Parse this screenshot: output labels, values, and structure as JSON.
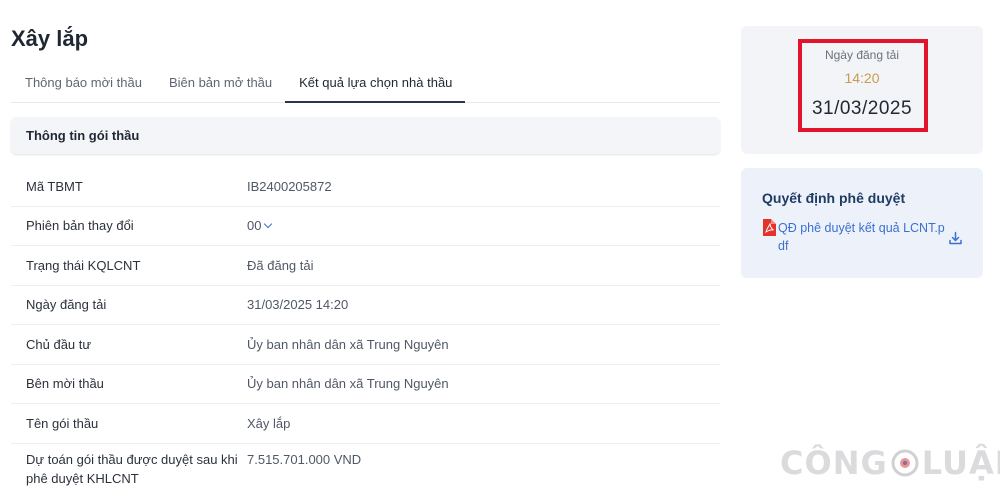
{
  "page": {
    "title": "Xây lắp"
  },
  "tabs": [
    {
      "label": "Thông báo mời thầu",
      "active": false
    },
    {
      "label": "Biên bản mở thầu",
      "active": false
    },
    {
      "label": "Kết quả lựa chọn nhà thầu",
      "active": true
    }
  ],
  "section": {
    "title": "Thông tin gói thầu"
  },
  "info": {
    "rows": [
      {
        "label": "Mã TBMT",
        "value": "IB2400205872"
      },
      {
        "label": "Phiên bản thay đổi",
        "value": "00"
      },
      {
        "label": "Trạng thái KQLCNT",
        "value": "Đã đăng tải"
      },
      {
        "label": "Ngày đăng tải",
        "value": "31/03/2025 14:20"
      },
      {
        "label": "Chủ đầu tư",
        "value": "Ủy ban nhân dân xã Trung Nguyên"
      },
      {
        "label": "Bên mời thầu",
        "value": "Ủy ban nhân dân xã Trung Nguyên"
      },
      {
        "label": "Tên gói thầu",
        "value": "Xây lắp"
      },
      {
        "label": "Dự toán gói thầu được duyệt sau khi phê duyệt KHLCNT",
        "value": "7.515.701.000 VND"
      }
    ]
  },
  "posted": {
    "label": "Ngày đăng tải",
    "time": "14:20",
    "date": "31/03/2025"
  },
  "decision": {
    "title": "Quyết định phê duyệt",
    "file_name": "QĐ phê duyệt kết quả LCNT.pdf",
    "file_icon": "pdf-icon",
    "download_icon": "download-icon"
  },
  "watermark": {
    "part1": "CÔNG",
    "part2": "LUẬN"
  },
  "colors": {
    "accent_blue": "#3b6fd1",
    "highlight_red": "#e2142b",
    "time_gold": "#c99b4e",
    "decision_bg": "#edf2fa"
  }
}
